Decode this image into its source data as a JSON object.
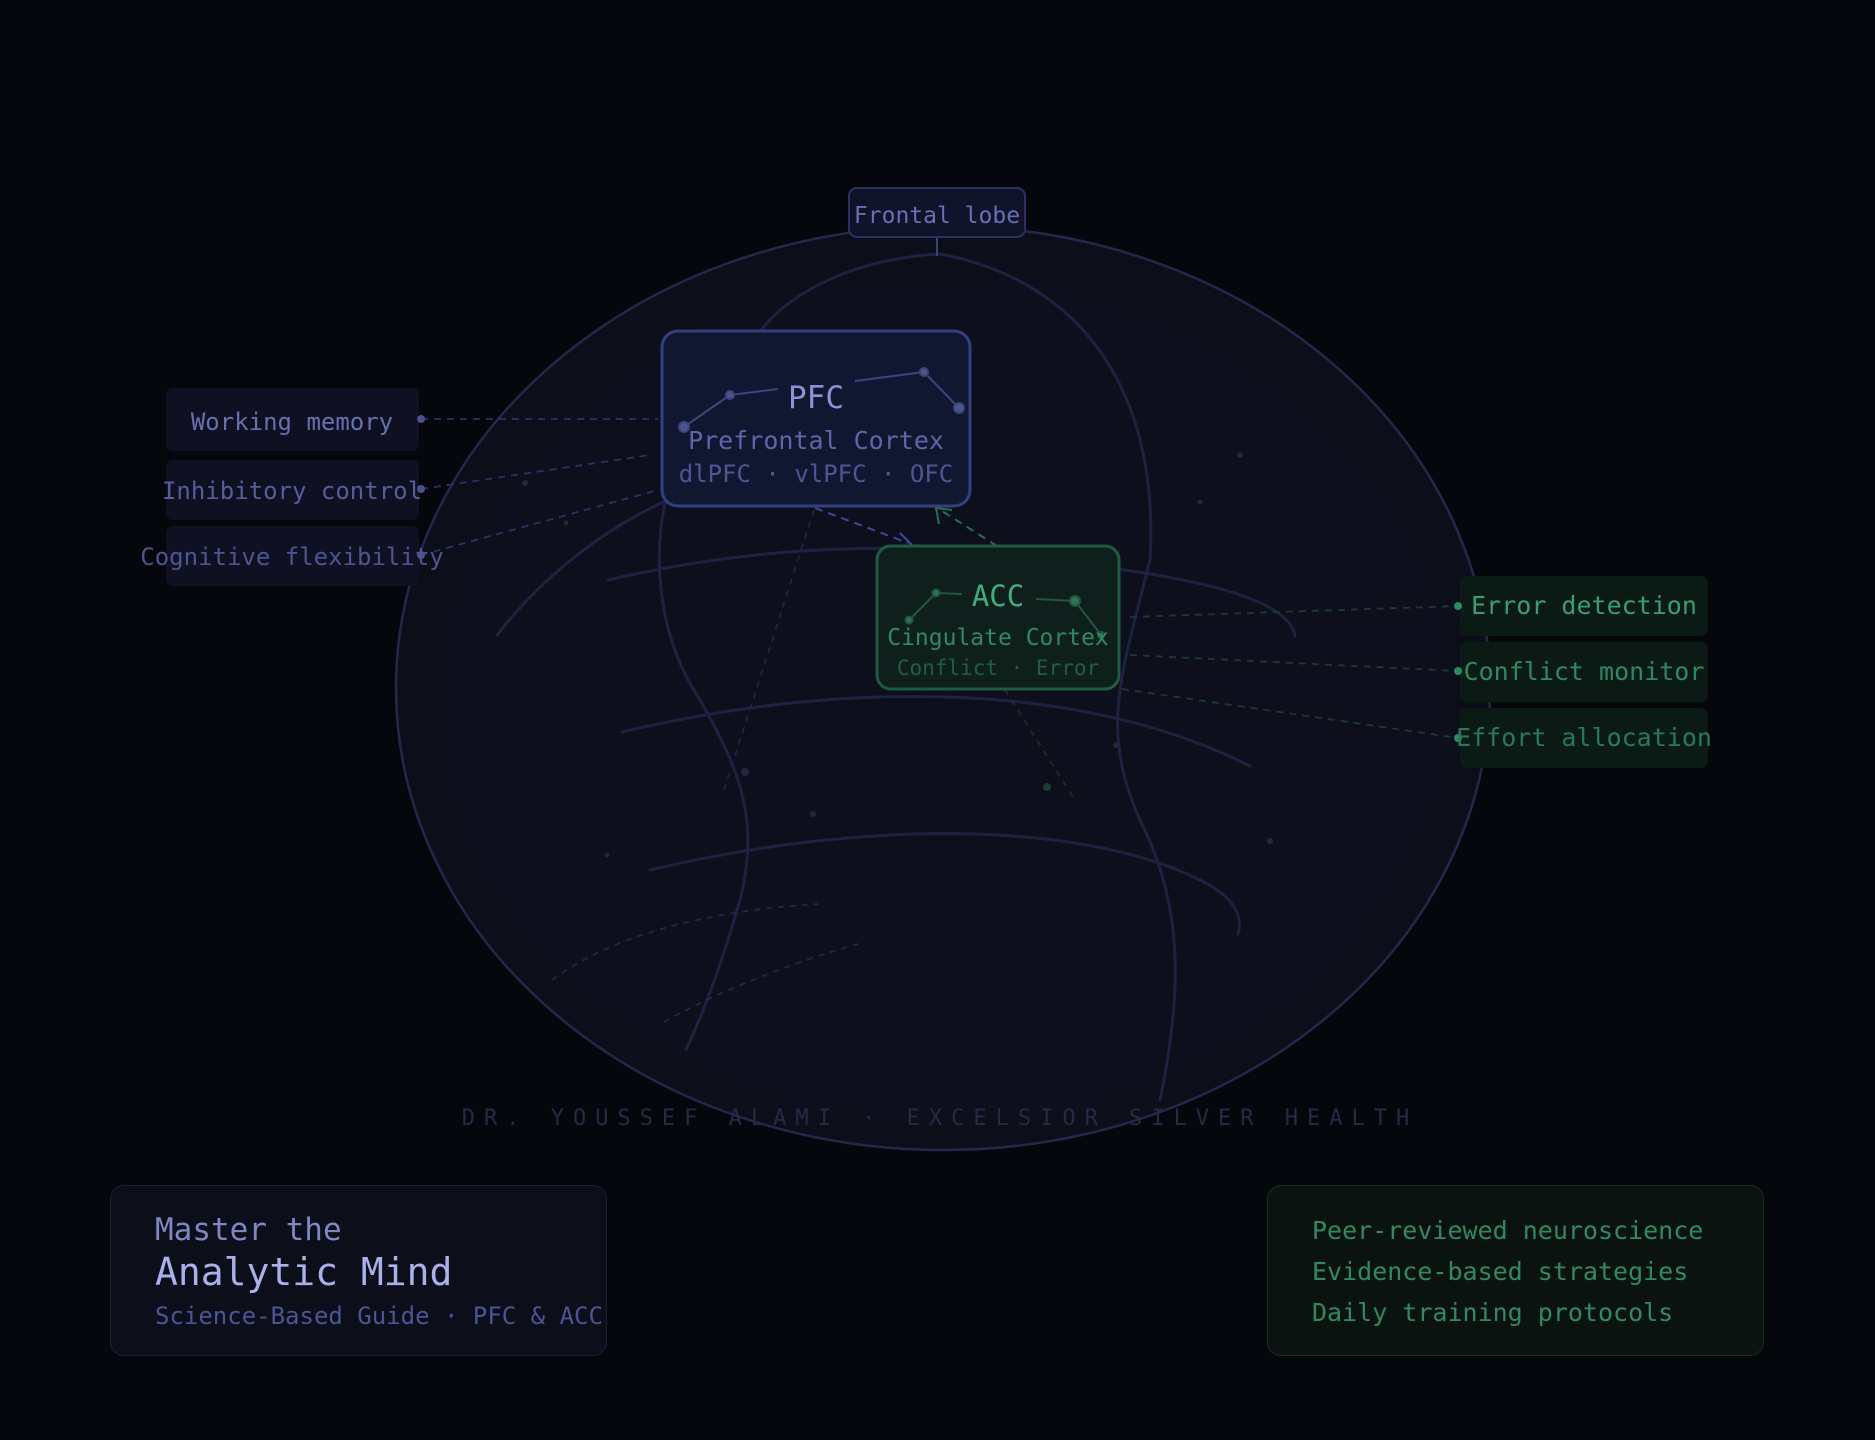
{
  "colors": {
    "background": "#06070d",
    "head_fill": "#0c0e1a",
    "head_stroke": "#23284a",
    "pfc_accent": "#6f78c0",
    "acc_accent": "#2f9c6a",
    "muted_text": "#2a2e48"
  },
  "diagram": {
    "frontal_lobe_label": "Frontal lobe",
    "pfc": {
      "abbr": "PFC",
      "name": "Prefrontal Cortex",
      "subregions": "dlPFC · vlPFC · OFC"
    },
    "acc": {
      "abbr": "ACC",
      "name": "Cingulate Cortex",
      "subtitle": "Conflict · Error"
    },
    "pfc_functions": [
      "Working memory",
      "Inhibitory control",
      "Cognitive flexibility"
    ],
    "acc_functions": [
      "Error detection",
      "Conflict monitor",
      "Effort allocation"
    ],
    "credit": "DR. YOUSSEF ALAMI · EXCELSIOR SILVER HEALTH"
  },
  "title_card": {
    "line1": "Master the",
    "line2": "Analytic Mind",
    "line3": "Science-Based Guide · PFC & ACC"
  },
  "features_card": {
    "items": [
      "Peer-reviewed neuroscience",
      "Evidence-based strategies",
      "Daily training protocols"
    ]
  }
}
